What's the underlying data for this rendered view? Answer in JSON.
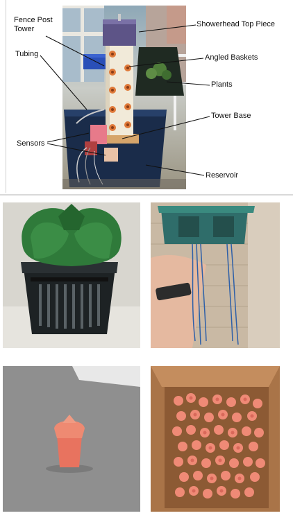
{
  "diagram": {
    "labels": {
      "fence_post_tower": "Fence Post\nTower",
      "tubing": "Tubing",
      "sensors": "Sensors",
      "showerhead_top_piece": "Showerhead Top Piece",
      "angled_baskets": "Angled Baskets",
      "plants": "Plants",
      "tower_base": "Tower Base",
      "reservoir": "Reservoir"
    }
  },
  "photos": [
    {
      "name": "green-basket-in-net-pot-photo"
    },
    {
      "name": "hand-holding-green-baskets-photo"
    },
    {
      "name": "single-pink-basket-photo"
    },
    {
      "name": "box-of-pink-baskets-photo"
    }
  ]
}
